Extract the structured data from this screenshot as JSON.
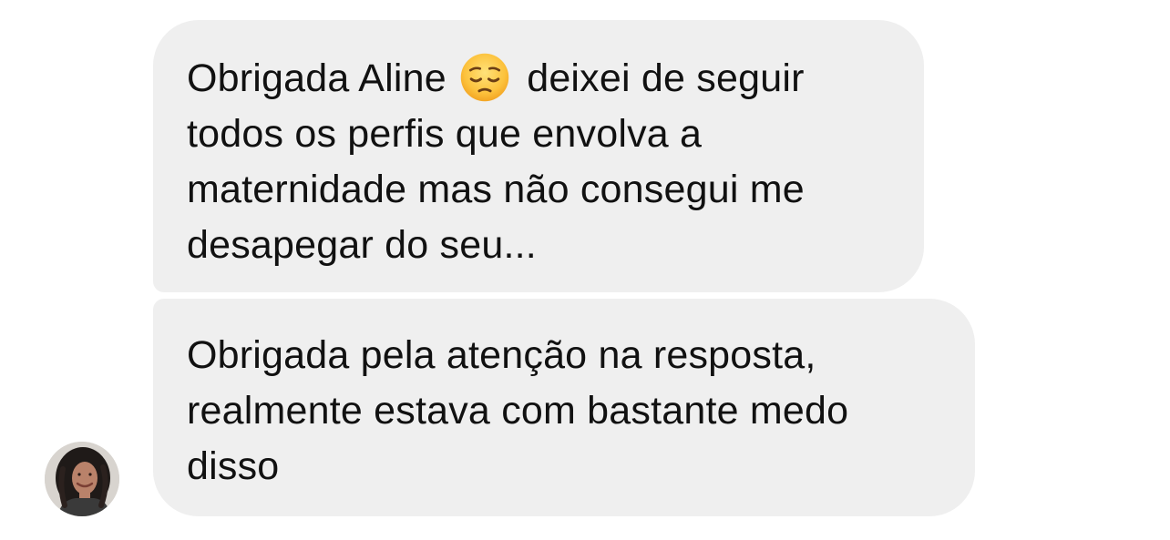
{
  "conversation": {
    "messages": [
      {
        "sender": "them",
        "lines": [
          {
            "before": "Obrigada Aline",
            "emoji": "pensive-face",
            "after": "deixei de seguir"
          },
          {
            "text": "todos os perfis que envolva a"
          },
          {
            "text": "maternidade mas não consegui me"
          },
          {
            "text": "desapegar do seu..."
          }
        ]
      },
      {
        "sender": "them",
        "lines": [
          {
            "text": "Obrigada pela atenção na resposta,"
          },
          {
            "text": "realmente estava com bastante medo"
          },
          {
            "text": "disso"
          }
        ]
      }
    ],
    "avatar_icon": "profile-photo",
    "colors": {
      "bubble_background": "#efefef",
      "text": "#111111",
      "page_background": "#ffffff"
    }
  }
}
